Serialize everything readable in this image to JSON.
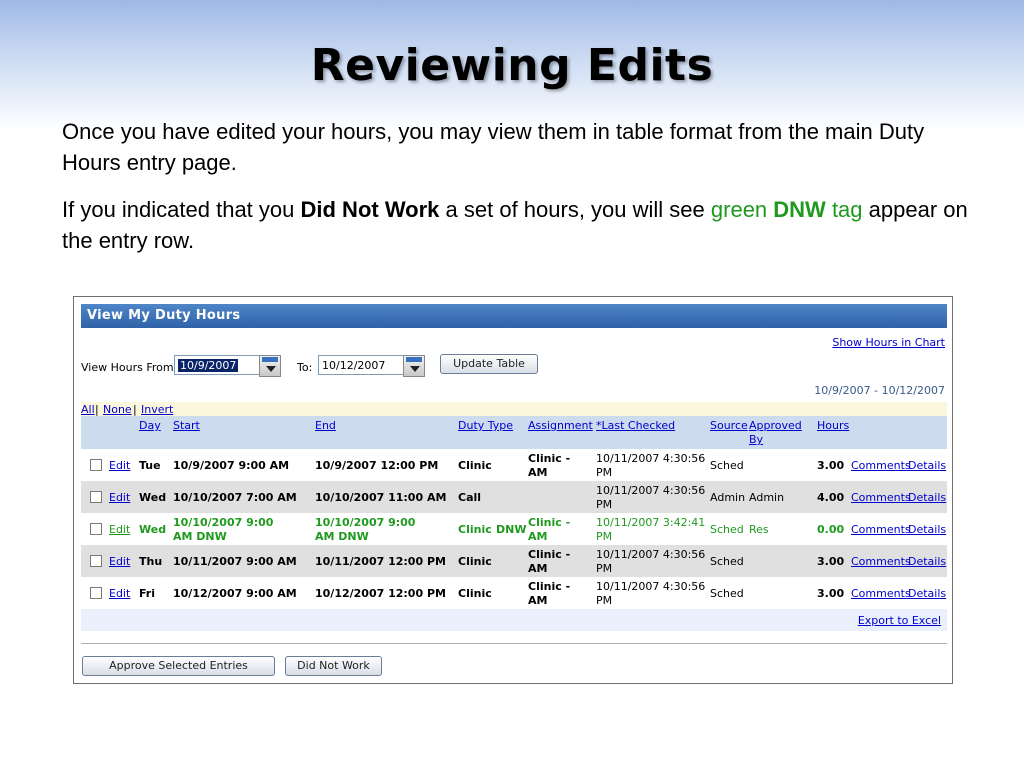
{
  "slide": {
    "title": "Reviewing Edits",
    "p1": "Once you have edited your hours, you may view them in table format from the main Duty Hours entry page.",
    "p2_a": "If you indicated that you ",
    "p2_b": "Did Not Work",
    "p2_c": " a set of hours, you will see ",
    "p2_d": "green ",
    "p2_e": "DNW",
    "p2_f": " tag",
    "p2_g": " appear on the entry row."
  },
  "panel": {
    "title": "View My Duty Hours",
    "show_chart_link": "Show Hours in Chart",
    "from_label": "View Hours From:",
    "from_value": "10/9/2007",
    "to_label": "To:",
    "to_value": "10/12/2007",
    "update_button": "Update Table",
    "range_text": "10/9/2007 - 10/12/2007",
    "select_all": "All",
    "select_none": "None",
    "select_invert": "Invert",
    "sep": "|",
    "export_link": "Export to Excel",
    "approve_button": "Approve Selected Entries",
    "dnw_button": "Did Not Work"
  },
  "columns": {
    "day": "Day",
    "start": "Start",
    "end": "End",
    "duty_type": "Duty Type",
    "assignment": "Assignment",
    "last_checked": "*Last Checked",
    "source": "Source",
    "approved_by_1": "Approved",
    "approved_by_2": "By",
    "hours": "Hours"
  },
  "rows": [
    {
      "edit": "Edit",
      "day": "Tue",
      "start_1": "10/9/2007 9:00 AM",
      "start_2": "",
      "end_1": "10/9/2007 12:00 PM",
      "end_2": "",
      "duty": "Clinic",
      "dnw": "",
      "assign_1": "Clinic -",
      "assign_2": "AM",
      "checked_1": "10/11/2007 4:30:56",
      "checked_2": "PM",
      "source": "Sched",
      "approved": "",
      "hours": "3.00",
      "comments": "Comments",
      "details": "Details"
    },
    {
      "edit": "Edit",
      "day": "Wed",
      "start_1": "10/10/2007 7:00 AM",
      "start_2": "",
      "end_1": "10/10/2007 11:00 AM",
      "end_2": "",
      "duty": "Call",
      "dnw": "",
      "assign_1": "",
      "assign_2": "",
      "checked_1": "10/11/2007 4:30:56",
      "checked_2": "PM",
      "source": "Admin",
      "approved": "Admin",
      "hours": "4.00",
      "comments": "Comments",
      "details": "Details"
    },
    {
      "edit": "Edit",
      "day": "Wed",
      "start_1": "10/10/2007 9:00",
      "start_2": "AM DNW",
      "end_1": "10/10/2007 9:00",
      "end_2": "AM DNW",
      "duty": "Clinic",
      "dnw": "DNW",
      "assign_1": "Clinic -",
      "assign_2": "AM",
      "checked_1": "10/11/2007 3:42:41",
      "checked_2": "PM",
      "source": "Sched",
      "approved": "Res",
      "hours": "0.00",
      "comments": "Comments",
      "details": "Details"
    },
    {
      "edit": "Edit",
      "day": "Thu",
      "start_1": "10/11/2007 9:00 AM",
      "start_2": "",
      "end_1": "10/11/2007 12:00 PM",
      "end_2": "",
      "duty": "Clinic",
      "dnw": "",
      "assign_1": "Clinic -",
      "assign_2": "AM",
      "checked_1": "10/11/2007 4:30:56",
      "checked_2": "PM",
      "source": "Sched",
      "approved": "",
      "hours": "3.00",
      "comments": "Comments",
      "details": "Details"
    },
    {
      "edit": "Edit",
      "day": "Fri",
      "start_1": "10/12/2007 9:00 AM",
      "start_2": "",
      "end_1": "10/12/2007 12:00 PM",
      "end_2": "",
      "duty": "Clinic",
      "dnw": "",
      "assign_1": "Clinic -",
      "assign_2": "AM",
      "checked_1": "10/11/2007 4:30:56",
      "checked_2": "PM",
      "source": "Sched",
      "approved": "",
      "hours": "3.00",
      "comments": "Comments",
      "details": "Details"
    }
  ]
}
